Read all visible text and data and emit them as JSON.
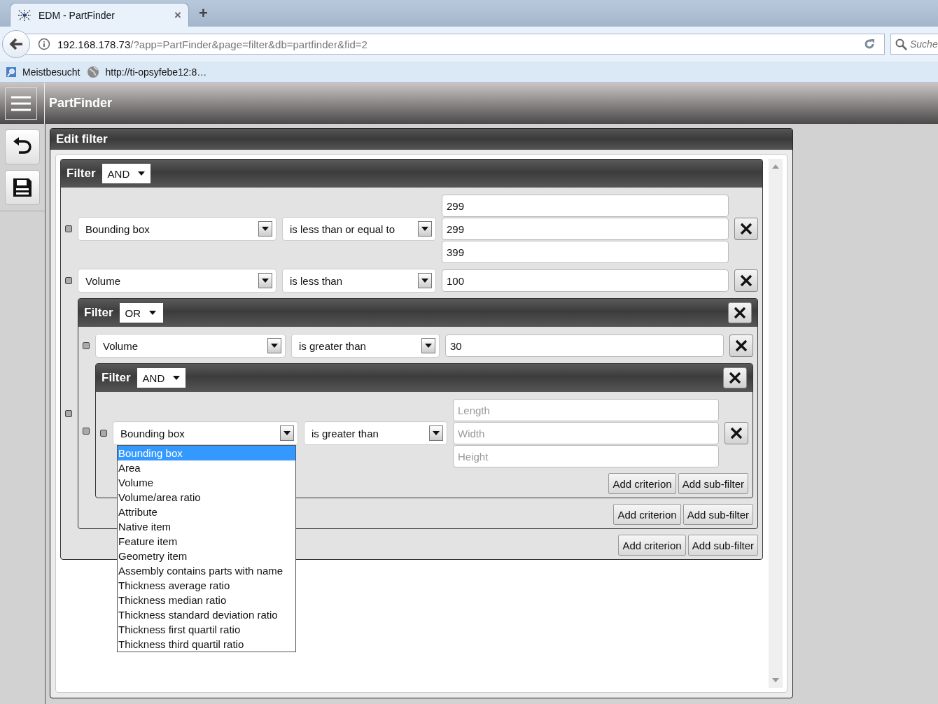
{
  "browser": {
    "tab": {
      "title": "EDM - PartFinder",
      "close": "×"
    },
    "new_tab": "+",
    "address": {
      "host": "192.168.178.73",
      "path": "/?app=PartFinder&page=filter&db=partfinder&fid=2"
    },
    "search": {
      "placeholder": "Suche"
    },
    "bookmarks": [
      {
        "kind": "folder",
        "label": "Meistbesucht"
      },
      {
        "kind": "site",
        "label": "http://ti-opsyfebe12:8…"
      }
    ]
  },
  "app": {
    "title": "PartFinder"
  },
  "panel": {
    "title": "Edit filter"
  },
  "filter": {
    "label": "Filter",
    "operator": "AND",
    "removable": false,
    "items": [
      {
        "kind": "criterion",
        "field": "Bounding box",
        "condition": "is less than or equal to",
        "values": [
          {
            "value": "299"
          },
          {
            "value": "299"
          },
          {
            "value": "399"
          }
        ]
      },
      {
        "kind": "criterion",
        "field": "Volume",
        "condition": "is less than",
        "values": [
          {
            "value": "100"
          }
        ]
      },
      {
        "kind": "filter",
        "label": "Filter",
        "operator": "OR",
        "removable": true,
        "items": [
          {
            "kind": "criterion",
            "field": "Volume",
            "condition": "is greater than",
            "values": [
              {
                "value": "30"
              }
            ]
          },
          {
            "kind": "filter",
            "label": "Filter",
            "operator": "AND",
            "removable": true,
            "items": [
              {
                "kind": "criterion",
                "field": "Bounding box",
                "condition": "is greater than",
                "values": [
                  {
                    "placeholder": "Length"
                  },
                  {
                    "placeholder": "Width"
                  },
                  {
                    "placeholder": "Height"
                  }
                ],
                "field_options": [
                  {
                    "label": "Bounding box",
                    "selected": true
                  },
                  {
                    "label": "Area",
                    "selected": false
                  },
                  {
                    "label": "Volume",
                    "selected": false
                  },
                  {
                    "label": "Volume/area ratio",
                    "selected": false
                  },
                  {
                    "label": "Attribute",
                    "selected": false
                  },
                  {
                    "label": "Native item",
                    "selected": false
                  },
                  {
                    "label": "Feature item",
                    "selected": false
                  },
                  {
                    "label": "Geometry item",
                    "selected": false
                  },
                  {
                    "label": "Assembly contains parts with name",
                    "selected": false
                  },
                  {
                    "label": "Thickness average ratio",
                    "selected": false
                  },
                  {
                    "label": "Thickness median ratio",
                    "selected": false
                  },
                  {
                    "label": "Thickness standard deviation ratio",
                    "selected": false
                  },
                  {
                    "label": "Thickness first quartil ratio",
                    "selected": false
                  },
                  {
                    "label": "Thickness third quartil ratio",
                    "selected": false
                  }
                ]
              }
            ],
            "buttons": [
              "Add criterion",
              "Add sub-filter"
            ]
          }
        ],
        "buttons": [
          "Add criterion",
          "Add sub-filter"
        ]
      }
    ],
    "buttons": [
      "Add criterion",
      "Add sub-filter"
    ]
  }
}
